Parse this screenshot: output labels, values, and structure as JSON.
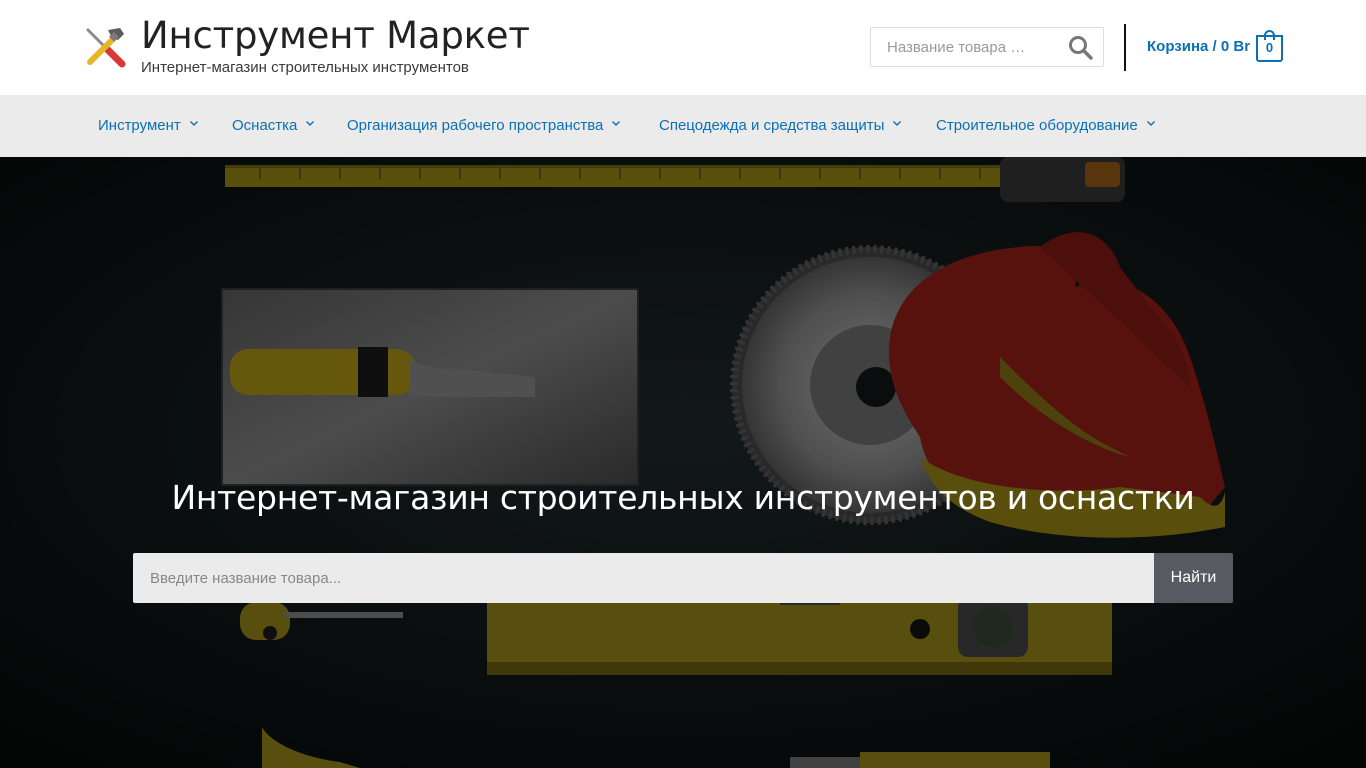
{
  "header": {
    "site_title": "Инструмент Маркет",
    "tagline": "Интернет-магазин строительных инструментов",
    "logo_icon": "tools-hammer-screwdriver-icon",
    "search": {
      "placeholder": "Название товара …",
      "icon": "search-icon"
    },
    "cart": {
      "label": "Корзина / 0 Br",
      "count": "0",
      "icon": "shopping-bag-icon"
    }
  },
  "nav": {
    "items": [
      {
        "label": "Инструмент"
      },
      {
        "label": "Оснастка"
      },
      {
        "label": "Организация рабочего пространства"
      },
      {
        "label": "Спецодежда и средства защиты"
      },
      {
        "label": "Строительное оборудование"
      }
    ]
  },
  "hero": {
    "title": "Интернет-магазин строительных инструментов и оснастки",
    "search": {
      "placeholder": "Введите название товара...",
      "button_label": "Найти"
    }
  },
  "colors": {
    "link_blue": "#0b70b4",
    "nav_bg": "#ebebeb",
    "hero_button": "#575b61"
  }
}
